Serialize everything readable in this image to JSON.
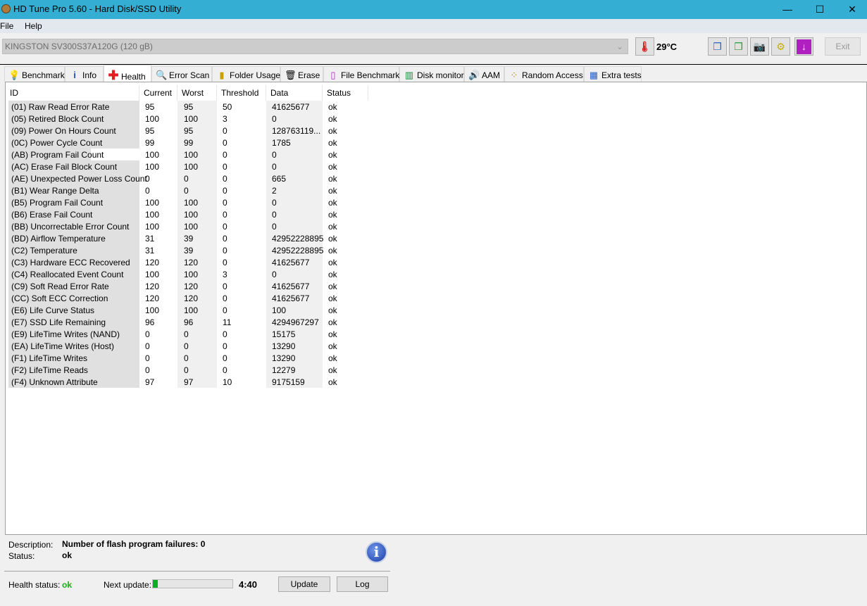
{
  "window": {
    "title": "HD Tune Pro 5.60 - Hard Disk/SSD Utility",
    "minimize": "—",
    "maximize": "☐",
    "close": "✕"
  },
  "menu": [
    {
      "label": "File"
    },
    {
      "label": "Help"
    }
  ],
  "toolbar": {
    "drive": "KINGSTON SV300S37A120G (120 gB)",
    "temperature": "29°C",
    "exit_label": "Exit",
    "buttons": [
      {
        "icon": "copy-info-icon"
      },
      {
        "icon": "copy-screen-icon"
      },
      {
        "icon": "camera-icon"
      },
      {
        "icon": "options-icon"
      },
      {
        "icon": "download-icon"
      }
    ]
  },
  "tabs": [
    {
      "label": "Benchmark",
      "icon": "lightbulb-icon"
    },
    {
      "label": "Info",
      "icon": "info-icon"
    },
    {
      "label": "Health",
      "icon": "red-cross-icon",
      "active": true
    },
    {
      "label": "Error Scan",
      "icon": "magnifier-icon"
    },
    {
      "label": "Folder Usage",
      "icon": "folder-icon"
    },
    {
      "label": "Erase",
      "icon": "trash-icon"
    },
    {
      "label": "File Benchmark",
      "icon": "file-benchmark-icon"
    },
    {
      "label": "Disk monitor",
      "icon": "bar-chart-icon"
    },
    {
      "label": "AAM",
      "icon": "speaker-icon"
    },
    {
      "label": "Random Access",
      "icon": "scatter-icon"
    },
    {
      "label": "Extra tests",
      "icon": "calculator-icon"
    }
  ],
  "table": {
    "headers": [
      "ID",
      "Current",
      "Worst",
      "Threshold",
      "Data",
      "Status"
    ],
    "rows": [
      [
        "(01) Raw Read Error Rate",
        "95",
        "95",
        "50",
        "41625677",
        "ok"
      ],
      [
        "(05) Retired Block Count",
        "100",
        "100",
        "3",
        "0",
        "ok"
      ],
      [
        "(09) Power On Hours Count",
        "95",
        "95",
        "0",
        "128763119...",
        "ok"
      ],
      [
        "(0C) Power Cycle Count",
        "99",
        "99",
        "0",
        "1785",
        "ok"
      ],
      [
        "(AB) Program Fail Count",
        "100",
        "100",
        "0",
        "0",
        "ok"
      ],
      [
        "(AC) Erase Fail Block Count",
        "100",
        "100",
        "0",
        "0",
        "ok"
      ],
      [
        "(AE) Unexpected Power Loss Count",
        "0",
        "0",
        "0",
        "665",
        "ok"
      ],
      [
        "(B1) Wear Range Delta",
        "0",
        "0",
        "0",
        "2",
        "ok"
      ],
      [
        "(B5) Program Fail Count",
        "100",
        "100",
        "0",
        "0",
        "ok"
      ],
      [
        "(B6) Erase Fail Count",
        "100",
        "100",
        "0",
        "0",
        "ok"
      ],
      [
        "(BB) Uncorrectable Error Count",
        "100",
        "100",
        "0",
        "0",
        "ok"
      ],
      [
        "(BD) Airflow Temperature",
        "31",
        "39",
        "0",
        "42952228895",
        "ok"
      ],
      [
        "(C2) Temperature",
        "31",
        "39",
        "0",
        "42952228895",
        "ok"
      ],
      [
        "(C3) Hardware ECC Recovered",
        "120",
        "120",
        "0",
        "41625677",
        "ok"
      ],
      [
        "(C4) Reallocated Event Count",
        "100",
        "100",
        "3",
        "0",
        "ok"
      ],
      [
        "(C9) Soft Read Error Rate",
        "120",
        "120",
        "0",
        "41625677",
        "ok"
      ],
      [
        "(CC) Soft ECC Correction",
        "120",
        "120",
        "0",
        "41625677",
        "ok"
      ],
      [
        "(E6) Life Curve Status",
        "100",
        "100",
        "0",
        "100",
        "ok"
      ],
      [
        "(E7) SSD Life Remaining",
        "96",
        "96",
        "11",
        "4294967297",
        "ok"
      ],
      [
        "(E9) LifeTime Writes (NAND)",
        "0",
        "0",
        "0",
        "15175",
        "ok"
      ],
      [
        "(EA) LifeTime Writes (Host)",
        "0",
        "0",
        "0",
        "13290",
        "ok"
      ],
      [
        "(F1) LifeTime Writes",
        "0",
        "0",
        "0",
        "13290",
        "ok"
      ],
      [
        "(F2) LifeTime Reads",
        "0",
        "0",
        "0",
        "12279",
        "ok"
      ],
      [
        "(F4) Unknown Attribute",
        "97",
        "97",
        "10",
        "9175159",
        "ok"
      ]
    ],
    "selected_row": 4
  },
  "details": {
    "description_label": "Description:",
    "description": "Number of flash program failures: 0",
    "status_label": "Status:",
    "status": "ok"
  },
  "footer": {
    "health_label": "Health status:",
    "health": "ok",
    "health_color": "#1aaa1a",
    "next_update_label": "Next update:",
    "progress_percent": 6,
    "countdown": "4:40",
    "update_label": "Update",
    "log_label": "Log"
  }
}
